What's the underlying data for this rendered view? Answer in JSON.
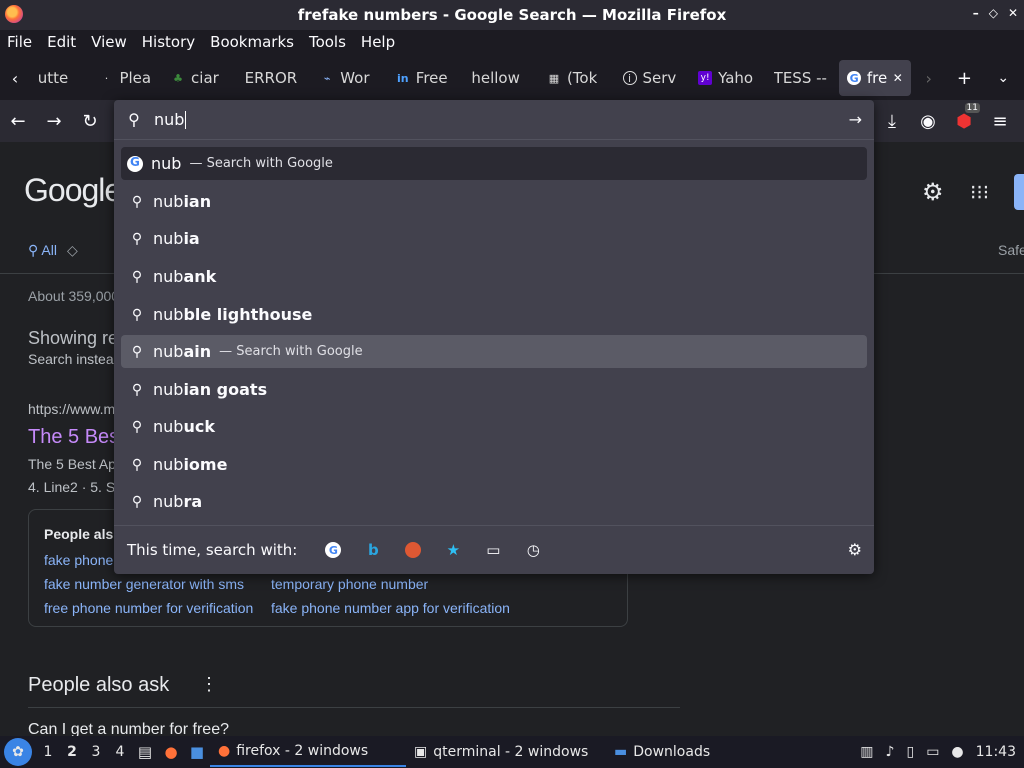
{
  "window": {
    "title": "frefake numbers - Google Search — Mozilla Firefox",
    "controls": [
      "–",
      "◇",
      "✕"
    ]
  },
  "menu": [
    "File",
    "Edit",
    "View",
    "History",
    "Bookmarks",
    "Tools",
    "Help"
  ],
  "tabs": [
    {
      "icon": "",
      "label": "utte"
    },
    {
      "icon": "",
      "label": "Plea"
    },
    {
      "icon": "",
      "label": "ciar"
    },
    {
      "icon": "",
      "label": "ERROR"
    },
    {
      "icon": "",
      "label": "Wor"
    },
    {
      "icon": "in",
      "label": "Free"
    },
    {
      "icon": "",
      "label": "hellow"
    },
    {
      "icon": "",
      "label": "(Tok"
    },
    {
      "icon": "i",
      "label": "Serv"
    },
    {
      "icon": "y!",
      "label": "Yaho"
    },
    {
      "icon": "",
      "label": "TESS --"
    },
    {
      "icon": "G",
      "label": "fre"
    }
  ],
  "extensions_badge": "11",
  "urlbar": {
    "typed": "nub"
  },
  "suggestions": [
    {
      "prefix": "nub",
      "suffix": "",
      "action": "— Search with Google",
      "kind": "first"
    },
    {
      "prefix": "nub",
      "suffix": "ian",
      "action": "",
      "kind": ""
    },
    {
      "prefix": "nub",
      "suffix": "ia",
      "action": "",
      "kind": ""
    },
    {
      "prefix": "nub",
      "suffix": "ank",
      "action": "",
      "kind": ""
    },
    {
      "prefix": "nub",
      "suffix": "ble lighthouse",
      "action": "",
      "kind": ""
    },
    {
      "prefix": "nub",
      "suffix": "ain",
      "action": "— Search with Google",
      "kind": "sel"
    },
    {
      "prefix": "nub",
      "suffix": "ian goats",
      "action": "",
      "kind": ""
    },
    {
      "prefix": "nub",
      "suffix": "uck",
      "action": "",
      "kind": ""
    },
    {
      "prefix": "nub",
      "suffix": "iome",
      "action": "",
      "kind": ""
    },
    {
      "prefix": "nub",
      "suffix": "ra",
      "action": "",
      "kind": ""
    }
  ],
  "oneoff_label": "This time, search with:",
  "page": {
    "logo": "Google",
    "tab_all": "All",
    "safe": "Safe",
    "about": "About 359,000",
    "showing": "Showing re",
    "search_instead": "Search instea",
    "result_url": "https://www.m",
    "result_title": "The 5 Bes",
    "snippet1": "The 5 Best Ap",
    "snippet2": "4. Line2 · 5. S",
    "people_also_search": "People als",
    "pas_links": [
      "fake phone",
      "fake number generator with sms",
      "temporary phone number",
      "free phone number for verification",
      "fake phone number app for verification"
    ],
    "people_also_ask": "People also ask",
    "paa_question": "Can I get a number for free?"
  },
  "taskbar": {
    "workspaces": [
      "1",
      "2",
      "3",
      "4"
    ],
    "tasks": [
      {
        "label": "firefox - 2 windows"
      },
      {
        "label": "qterminal - 2 windows"
      },
      {
        "label": "Downloads"
      }
    ],
    "clock": "11:43"
  }
}
